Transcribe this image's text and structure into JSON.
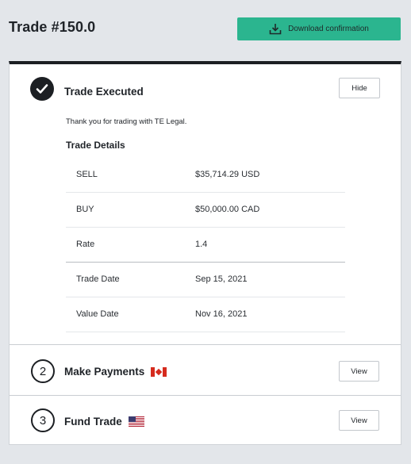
{
  "header": {
    "title": "Trade #150.0",
    "download_label": "Download confirmation"
  },
  "sections": {
    "executed": {
      "title": "Trade Executed",
      "button_label": "Hide",
      "thanks": "Thank you for trading with TE Legal.",
      "details_title": "Trade Details",
      "rows": [
        {
          "label": "SELL",
          "value": "$35,714.29 USD"
        },
        {
          "label": "BUY",
          "value": "$50,000.00 CAD"
        },
        {
          "label": "Rate",
          "value": "1.4"
        },
        {
          "label": "Trade Date",
          "value": "Sep 15, 2021"
        },
        {
          "label": "Value Date",
          "value": "Nov 16, 2021"
        }
      ]
    },
    "payments": {
      "step": "2",
      "title": "Make Payments",
      "flag": "canada-flag-icon",
      "button_label": "View"
    },
    "fund": {
      "step": "3",
      "title": "Fund Trade",
      "flag": "usa-flag-icon",
      "button_label": "View"
    }
  },
  "colors": {
    "accent": "#2bb58f",
    "dark": "#1c1f23",
    "background": "#e3e6ea"
  }
}
